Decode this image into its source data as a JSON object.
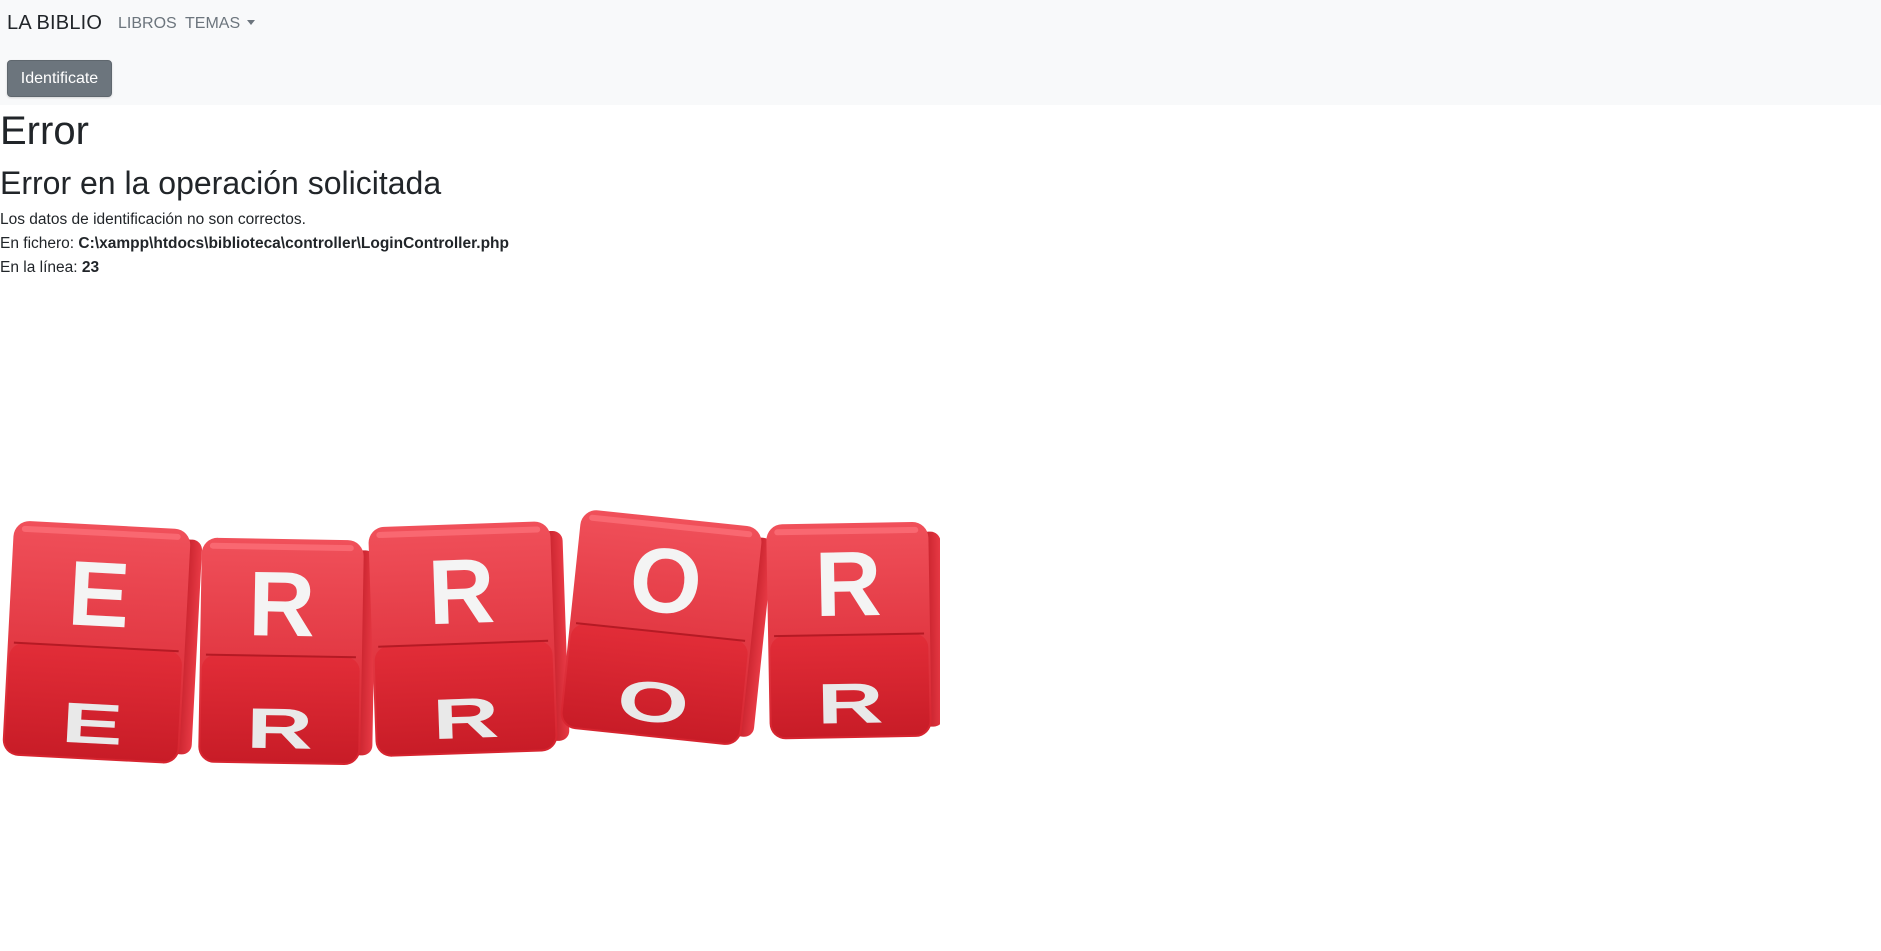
{
  "nav": {
    "brand": "LA BIBLIO",
    "links": [
      "LIBROS",
      "TEMAS"
    ],
    "login_button": "Identificate"
  },
  "error": {
    "title": "Error",
    "subtitle": "Error en la operación solicitada",
    "message": "Los datos de identificación no son correctos.",
    "file_label": "En fichero:",
    "file_path": "C:\\xampp\\htdocs\\biblioteca\\controller\\LoginController.php",
    "line_label": "En la línea:",
    "line_number": "23"
  },
  "image": {
    "letters": [
      "E",
      "R",
      "R",
      "O",
      "R"
    ]
  },
  "colors": {
    "navbar_bg": "#f8f9fa",
    "button_bg": "#6c757d",
    "dice_red": "#e0303c"
  }
}
